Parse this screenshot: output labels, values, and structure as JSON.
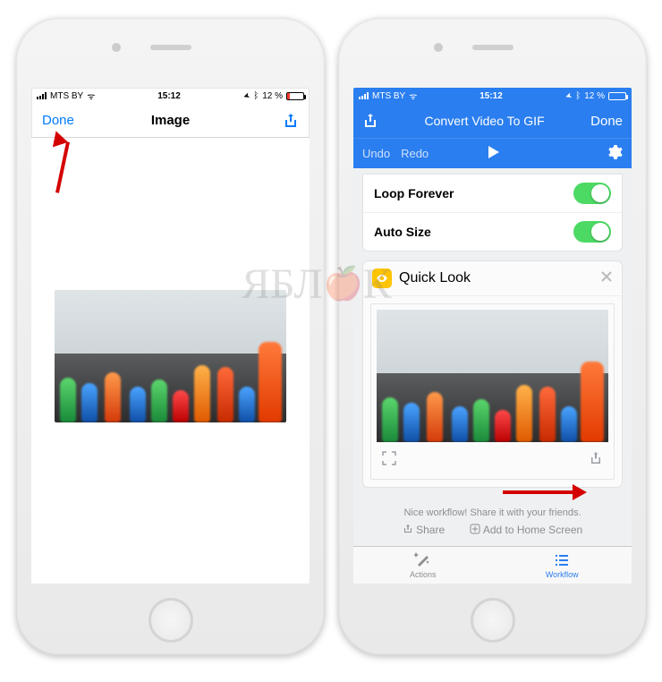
{
  "status": {
    "carrier": "MTS BY",
    "time": "15:12",
    "battery_pct": "12 %",
    "wifi_glyph": "ᯤ",
    "loc_glyph": "➤",
    "bt_glyph": "ᛒ"
  },
  "left": {
    "nav_done": "Done",
    "nav_title": "Image"
  },
  "right": {
    "nav_title": "Convert Video To GIF",
    "nav_done": "Done",
    "toolbar_undo": "Undo",
    "toolbar_redo": "Redo",
    "row_loop": "Loop Forever",
    "row_autosize": "Auto Size",
    "quicklook": "Quick Look",
    "footer_text": "Nice workflow! Share it with your friends.",
    "footer_share": "Share",
    "footer_addhome": "Add to Home Screen",
    "tab_actions": "Actions",
    "tab_workflow": "Workflow"
  },
  "watermark": "ЯБЛЫК"
}
